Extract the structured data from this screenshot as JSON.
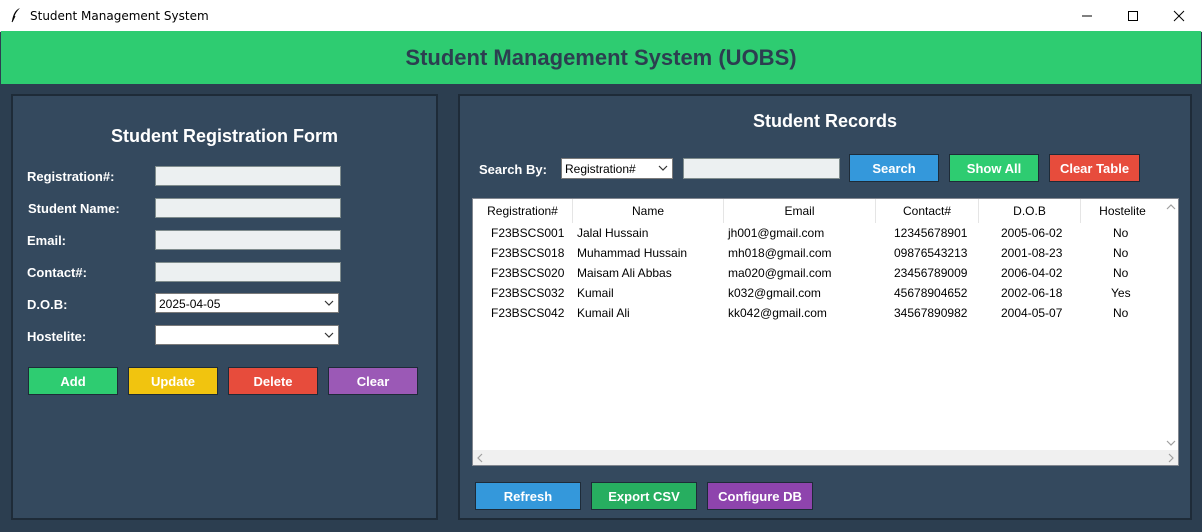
{
  "window": {
    "title": "Student Management System",
    "controls": {
      "minimize_icon": "minimize-icon",
      "maximize_icon": "maximize-icon",
      "close_icon": "close-icon"
    }
  },
  "header": {
    "title": "Student Management System (UOBS)"
  },
  "form": {
    "title": "Student Registration Form",
    "fields": [
      {
        "label": "Registration#:",
        "value": ""
      },
      {
        "label": "Student Name:",
        "value": ""
      },
      {
        "label": "Email:",
        "value": ""
      },
      {
        "label": "Contact#:",
        "value": ""
      }
    ],
    "dob": {
      "label": "D.O.B:",
      "value": "2025-04-05"
    },
    "hostelite": {
      "label": "Hostelite:",
      "value": ""
    },
    "buttons": {
      "add": "Add",
      "update": "Update",
      "delete": "Delete",
      "clear": "Clear"
    }
  },
  "records": {
    "title": "Student Records",
    "search_by_label": "Search By:",
    "search_by_value": "Registration#",
    "search_value": "",
    "buttons": {
      "search": "Search",
      "show_all": "Show All",
      "clear_table": "Clear Table"
    },
    "columns": [
      "Registration#",
      "Name",
      "Email",
      "Contact#",
      "D.O.B",
      "Hostelite"
    ],
    "rows": [
      [
        "F23BSCS001",
        "Jalal Hussain",
        "jh001@gmail.com",
        "12345678901",
        "2005-06-02",
        "No"
      ],
      [
        "F23BSCS018",
        "Muhammad Hussain",
        "mh018@gmail.com",
        "09876543213",
        "2001-08-23",
        "No"
      ],
      [
        "F23BSCS020",
        "Maisam Ali Abbas",
        "ma020@gmail.com",
        "23456789009",
        "2006-04-02",
        "No"
      ],
      [
        "F23BSCS032",
        "Kumail",
        "k032@gmail.com",
        "45678904652",
        "2002-06-18",
        "Yes"
      ],
      [
        "F23BSCS042",
        "Kumail Ali",
        "kk042@gmail.com",
        "34567890982",
        "2004-05-07",
        "No"
      ]
    ],
    "bottom_buttons": {
      "refresh": "Refresh",
      "export_csv": "Export CSV",
      "configure_db": "Configure DB"
    }
  },
  "colors": {
    "background": "#2c3e50",
    "panel": "#34495e",
    "header": "#2ecc71",
    "green": "#2ecc71",
    "yellow": "#f1c40f",
    "red": "#e74c3c",
    "purple": "#9b59b6",
    "blue": "#3498db",
    "dark_green": "#27ae60",
    "dark_purple": "#8e44ad"
  }
}
